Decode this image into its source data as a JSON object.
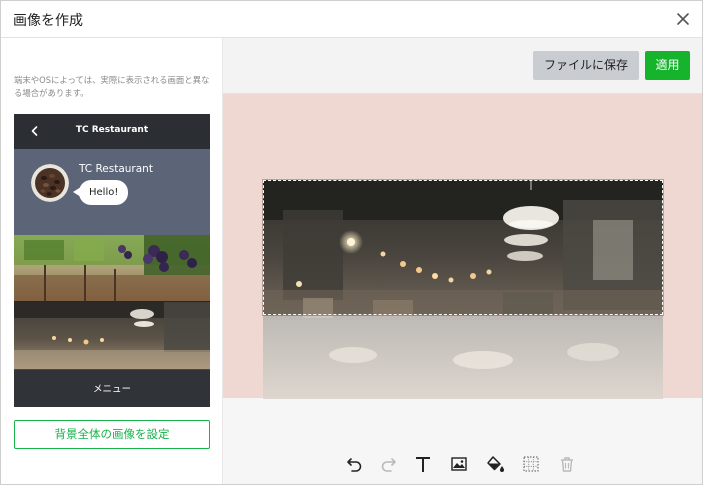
{
  "dialog": {
    "title": "画像を作成",
    "close_icon": "close-icon"
  },
  "left": {
    "note": "端末やOSによっては、実際に表示される画面と異なる場合があります。",
    "preview": {
      "header_title": "TC Restaurant",
      "back_icon": "chevron-left-icon",
      "chat_name": "TC Restaurant",
      "chat_message": "Hello!",
      "menu_label": "メニュー"
    },
    "set_background_label": "背景全体の画像を設定"
  },
  "right": {
    "save_label": "ファイルに保存",
    "apply_label": "適用",
    "toolbar": {
      "icons": [
        "undo-icon",
        "redo-icon",
        "text-icon",
        "image-icon",
        "fill-icon",
        "grid-icon",
        "trash-icon"
      ]
    }
  },
  "colors": {
    "accent": "#16b32d",
    "canvas_background": "#efd8d1",
    "chat_background": "#5c6478",
    "phone_background": "#2f3338"
  }
}
